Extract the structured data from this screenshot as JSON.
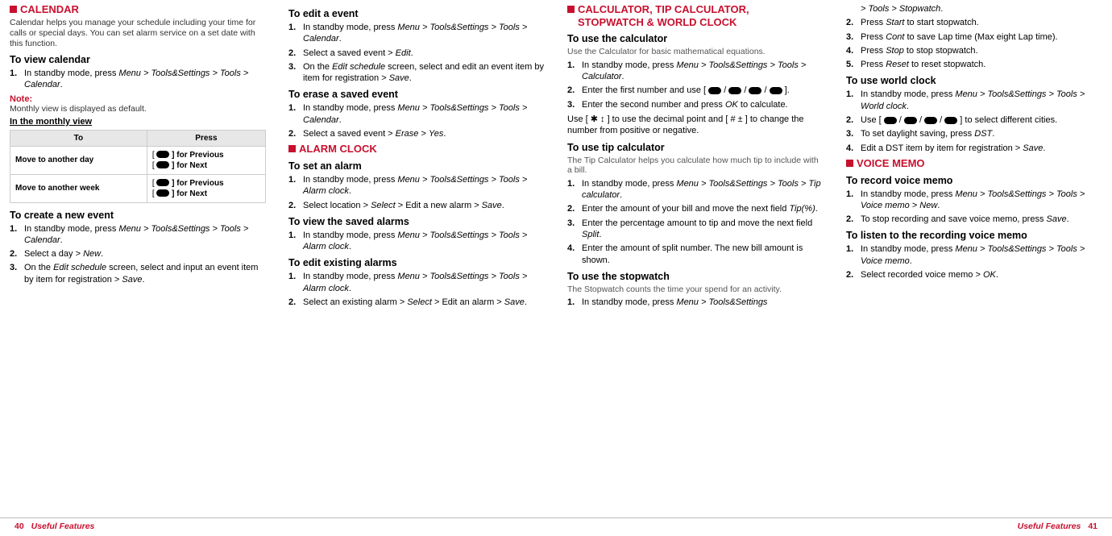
{
  "col1": {
    "h1": "CALENDAR",
    "intro": "Calendar helps you manage your schedule including your time for calls or special days. You can set alarm service on a set date with this function.",
    "view_cal": "To view calendar",
    "view_cal_steps": [
      "In standby mode, press "
    ],
    "menu_path": "Menu > Tools&Settings > Tools > Calendar",
    "note_label": "Note:",
    "note_text": "Monthly view is displayed as default.",
    "monthly_view": "In the monthly view",
    "table": {
      "h1": "To",
      "h2": "Press",
      "r1c1": "Move to another day",
      "r1c2a": "[ ",
      "r1c2b": " ] for Previous",
      "r1c2c": "[ ",
      "r1c2d": " ] for Next",
      "r2c1": "Move to another week",
      "r2c2a": "[ ",
      "r2c2b": " ] for Previous",
      "r2c2c": "[ ",
      "r2c2d": " ] for Next"
    },
    "create_event": "To create a new event",
    "ce1": "In standby mode, press ",
    "ce_path": "Menu > Tools&Settings > Tools > Calendar",
    "ce2a": "Select a day > ",
    "ce2b": "New",
    "ce3a": "On the ",
    "ce3b": "Edit schedule",
    "ce3c": " screen, select and input an event item by item for registration > ",
    "ce3d": "Save"
  },
  "col2": {
    "edit_event": "To edit a event",
    "ee1": "In standby mode, press ",
    "ee_path": "Menu > Tools&Settings > Tools > Calendar",
    "ee2a": "Select a saved event > ",
    "ee2b": "Edit",
    "ee3a": "On the ",
    "ee3b": "Edit schedule",
    "ee3c": " screen, select and edit an event item by item for registration > ",
    "ee3d": "Save",
    "erase_event": "To erase a saved event",
    "er1": "In standby mode, press ",
    "er_path": "Menu > Tools&Settings > Tools > Calendar",
    "er2a": "Select a saved event > ",
    "er2b": "Erase",
    "er2c": " > ",
    "er2d": "Yes",
    "h2": "ALARM CLOCK",
    "set_alarm": "To set an alarm",
    "sa1": "In standby mode, press ",
    "sa_path": "Menu > Tools&Settings > Tools > Alarm clock",
    "sa2a": "Select location > ",
    "sa2b": "Select",
    "sa2c": " > Edit a new alarm > ",
    "sa2d": "Save",
    "view_alarms": "To view the saved alarms",
    "va1": "In standby mode, press ",
    "va_path": "Menu > Tools&Settings > Tools > Alarm clock",
    "edit_alarms": "To edit existing alarms",
    "ea1": "In standby mode, press ",
    "ea_path": "Menu > Tools&Settings > Tools > Alarm clock",
    "ea2a": "Select an existing alarm > ",
    "ea2b": "Select",
    "ea2c": " > Edit an alarm > ",
    "ea2d": "Save"
  },
  "col3": {
    "h1a": "CALCULATOR, TIP CALCULATOR,",
    "h1b": "STOPWATCH & WORLD CLOCK",
    "use_calc": "To use the calculator",
    "calc_desc": "Use the Calculator for basic mathematical equations.",
    "uc1": "In standby mode, press ",
    "uc_path": "Menu > Tools&Settings > Tools > Calculator",
    "uc2a": "Enter the first number and use [ ",
    "uc2b": " / ",
    "uc2c": " / ",
    "uc2d": " / ",
    "uc2e": " ].",
    "uc3a": "Enter the second number and press ",
    "uc3b": "OK",
    "uc3c": " to calculate.",
    "calc_note_a": "Use [ ",
    "calc_note_b": " ] to use the decimal point and [ ",
    "calc_note_c": " ] to change the number from positive or negative.",
    "use_tip": "To use tip calculator",
    "tip_desc": "The Tip Calculator helps you calculate how much tip to include with a bill.",
    "tp1": "In standby mode, press ",
    "tp_path": "Menu > Tools&Settings > Tools > Tip calculator",
    "tp2a": "Enter the amount of your bill and move the next field ",
    "tp2b": "Tip(%)",
    "tp3a": "Enter the percentage amount to tip and move the next field ",
    "tp3b": "Split",
    "tp4": "Enter the amount of split number. The new bill amount is shown.",
    "use_sw": "To use the stopwatch",
    "sw_desc": "The Stopwatch counts the time your spend for an activity.",
    "sw1": "In standby mode, press ",
    "sw_path": "Menu > Tools&Settings"
  },
  "col4": {
    "sw_cont": "> Tools > Stopwatch",
    "sw2a": "Press ",
    "sw2b": "Start",
    "sw2c": " to start stopwatch.",
    "sw3a": "Press ",
    "sw3b": "Cont",
    "sw3c": " to save Lap time (Max eight Lap time).",
    "sw4a": "Press ",
    "sw4b": "Stop",
    "sw4c": " to stop stopwatch.",
    "sw5a": "Press ",
    "sw5b": "Reset",
    "sw5c": " to reset stopwatch.",
    "use_wc": "To use world clock",
    "wc1": "In standby mode, press ",
    "wc_path": "Menu > Tools&Settings > Tools > World clock",
    "wc2a": "Use [ ",
    "wc2b": " / ",
    "wc2c": " / ",
    "wc2d": " / ",
    "wc2e": " ] to select different cities.",
    "wc3a": "To set daylight saving, press ",
    "wc3b": "DST",
    "wc4a": "Edit a DST item by item for registration > ",
    "wc4b": "Save",
    "h_vm": "VOICE MEMO",
    "rec_vm": "To record voice memo",
    "rv1": "In standby mode, press ",
    "rv_path": "Menu > Tools&Settings > Tools > Voice memo > New",
    "rv2a": "To stop recording and save voice memo, press ",
    "rv2b": "Save",
    "listen_vm": "To listen to the recording voice memo",
    "lv1": "In standby mode, press ",
    "lv_path": "Menu > Tools&Settings > Tools > Voice memo",
    "lv2a": "Select recorded voice memo > ",
    "lv2b": "OK"
  },
  "footer": {
    "left_pg": "40",
    "left_t": "Useful Features",
    "right_t": "Useful Features",
    "right_pg": "41"
  },
  "icons": {
    "star": "✱",
    "arrow": "↕",
    "hash": "#",
    "plusminus": "±"
  }
}
